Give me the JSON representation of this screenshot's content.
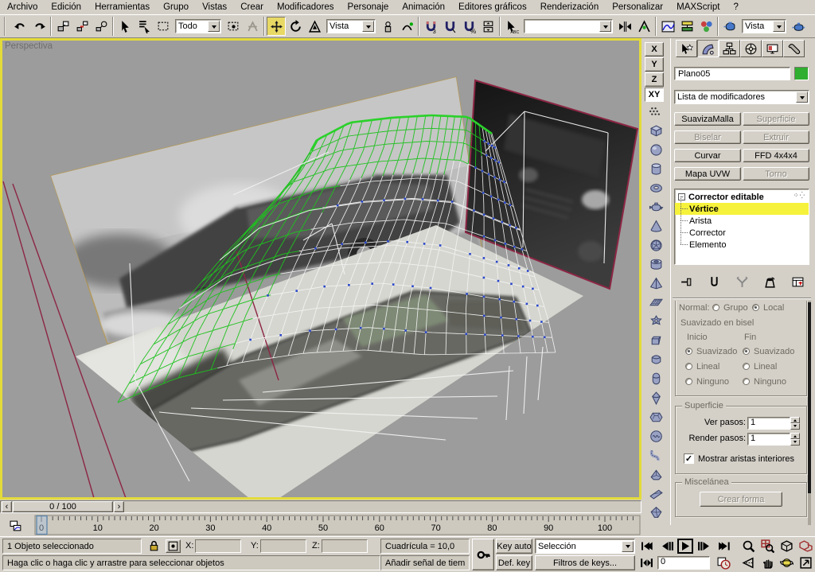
{
  "menu": {
    "items": [
      "Archivo",
      "Edición",
      "Herramientas",
      "Grupo",
      "Vistas",
      "Crear",
      "Modificadores",
      "Personaje",
      "Animación",
      "Editores gráficos",
      "Renderización",
      "Personalizar",
      "MAXScript",
      "?"
    ]
  },
  "toolbar": {
    "selection_filter": "Todo",
    "reference_coord": "Vista",
    "named_selection": "",
    "render_type": "Vista"
  },
  "viewport": {
    "label": "Perspectiva",
    "colors": {
      "border": "#e3db3a",
      "background": "#9c9c9c",
      "mesh_green": "#1fc21f",
      "mesh_white": "#f4f4f4",
      "vertex_blue": "#2846c8",
      "plane_edge_red": "#8c2644"
    }
  },
  "axis_strip": {
    "x": "X",
    "y": "Y",
    "z": "Z",
    "xy": "XY",
    "shape_icons": [
      "box",
      "sphere",
      "cylinder",
      "torus",
      "teapot",
      "cone",
      "geosphere",
      "tube",
      "pyramid",
      "plane-grid",
      "torus-knot",
      "chamfer-box",
      "oil-tank",
      "capsule",
      "spindle",
      "gengon",
      "ring-wave",
      "hose",
      "prism",
      "wedge",
      "platonic"
    ]
  },
  "command_panel": {
    "object_name": "Plano05",
    "modifier_list_label": "Lista de modificadores",
    "buttons": [
      {
        "label": "SuavizaMalla",
        "enabled": true
      },
      {
        "label": "Superficie",
        "enabled": false
      },
      {
        "label": "Biselar",
        "enabled": false
      },
      {
        "label": "Extruir",
        "enabled": false
      },
      {
        "label": "Curvar",
        "enabled": true
      },
      {
        "label": "FFD 4x4x4",
        "enabled": true
      },
      {
        "label": "Mapa UVW",
        "enabled": true
      },
      {
        "label": "Torno",
        "enabled": false
      }
    ],
    "stack": {
      "root": "Corrector editable",
      "items": [
        "Vértice",
        "Arista",
        "Corrector",
        "Elemento"
      ],
      "selected": "Vértice"
    },
    "rollout": {
      "normal_label": "Normal:",
      "grupo": "Grupo",
      "local": "Local",
      "bevel_smoothing": "Suavizado en bisel",
      "inicio": "Inicio",
      "fin": "Fin",
      "radio_rows": [
        "Suavizado",
        "Lineal",
        "Ninguno"
      ],
      "superficie": "Superficie",
      "ver_pasos": "Ver pasos:",
      "render_pasos": "Render pasos:",
      "ver_pasos_value": "1",
      "render_pasos_value": "1",
      "mostrar": "Mostrar aristas interiores",
      "miscelanea": "Miscelánea",
      "crear_forma": "Crear forma"
    }
  },
  "timeline": {
    "slider_label": "0 / 100",
    "ticks": [
      "0",
      "10",
      "20",
      "30",
      "40",
      "50",
      "60",
      "70",
      "80",
      "90",
      "100"
    ],
    "handle": "0"
  },
  "status": {
    "selection": "1 Objeto seleccionado",
    "x_label": "X:",
    "y_label": "Y:",
    "z_label": "Z:",
    "grid": "Cuadrícula = 10,0",
    "prompt": "Haga clic o haga clic y arrastre para seleccionar objetos",
    "add_time_tag": "Añadir señal de tiem",
    "key_auto": "Key auto",
    "def_key": "Def. key",
    "seleccion": "Selección",
    "key_filters": "Filtros de keys...",
    "frame": "0"
  }
}
